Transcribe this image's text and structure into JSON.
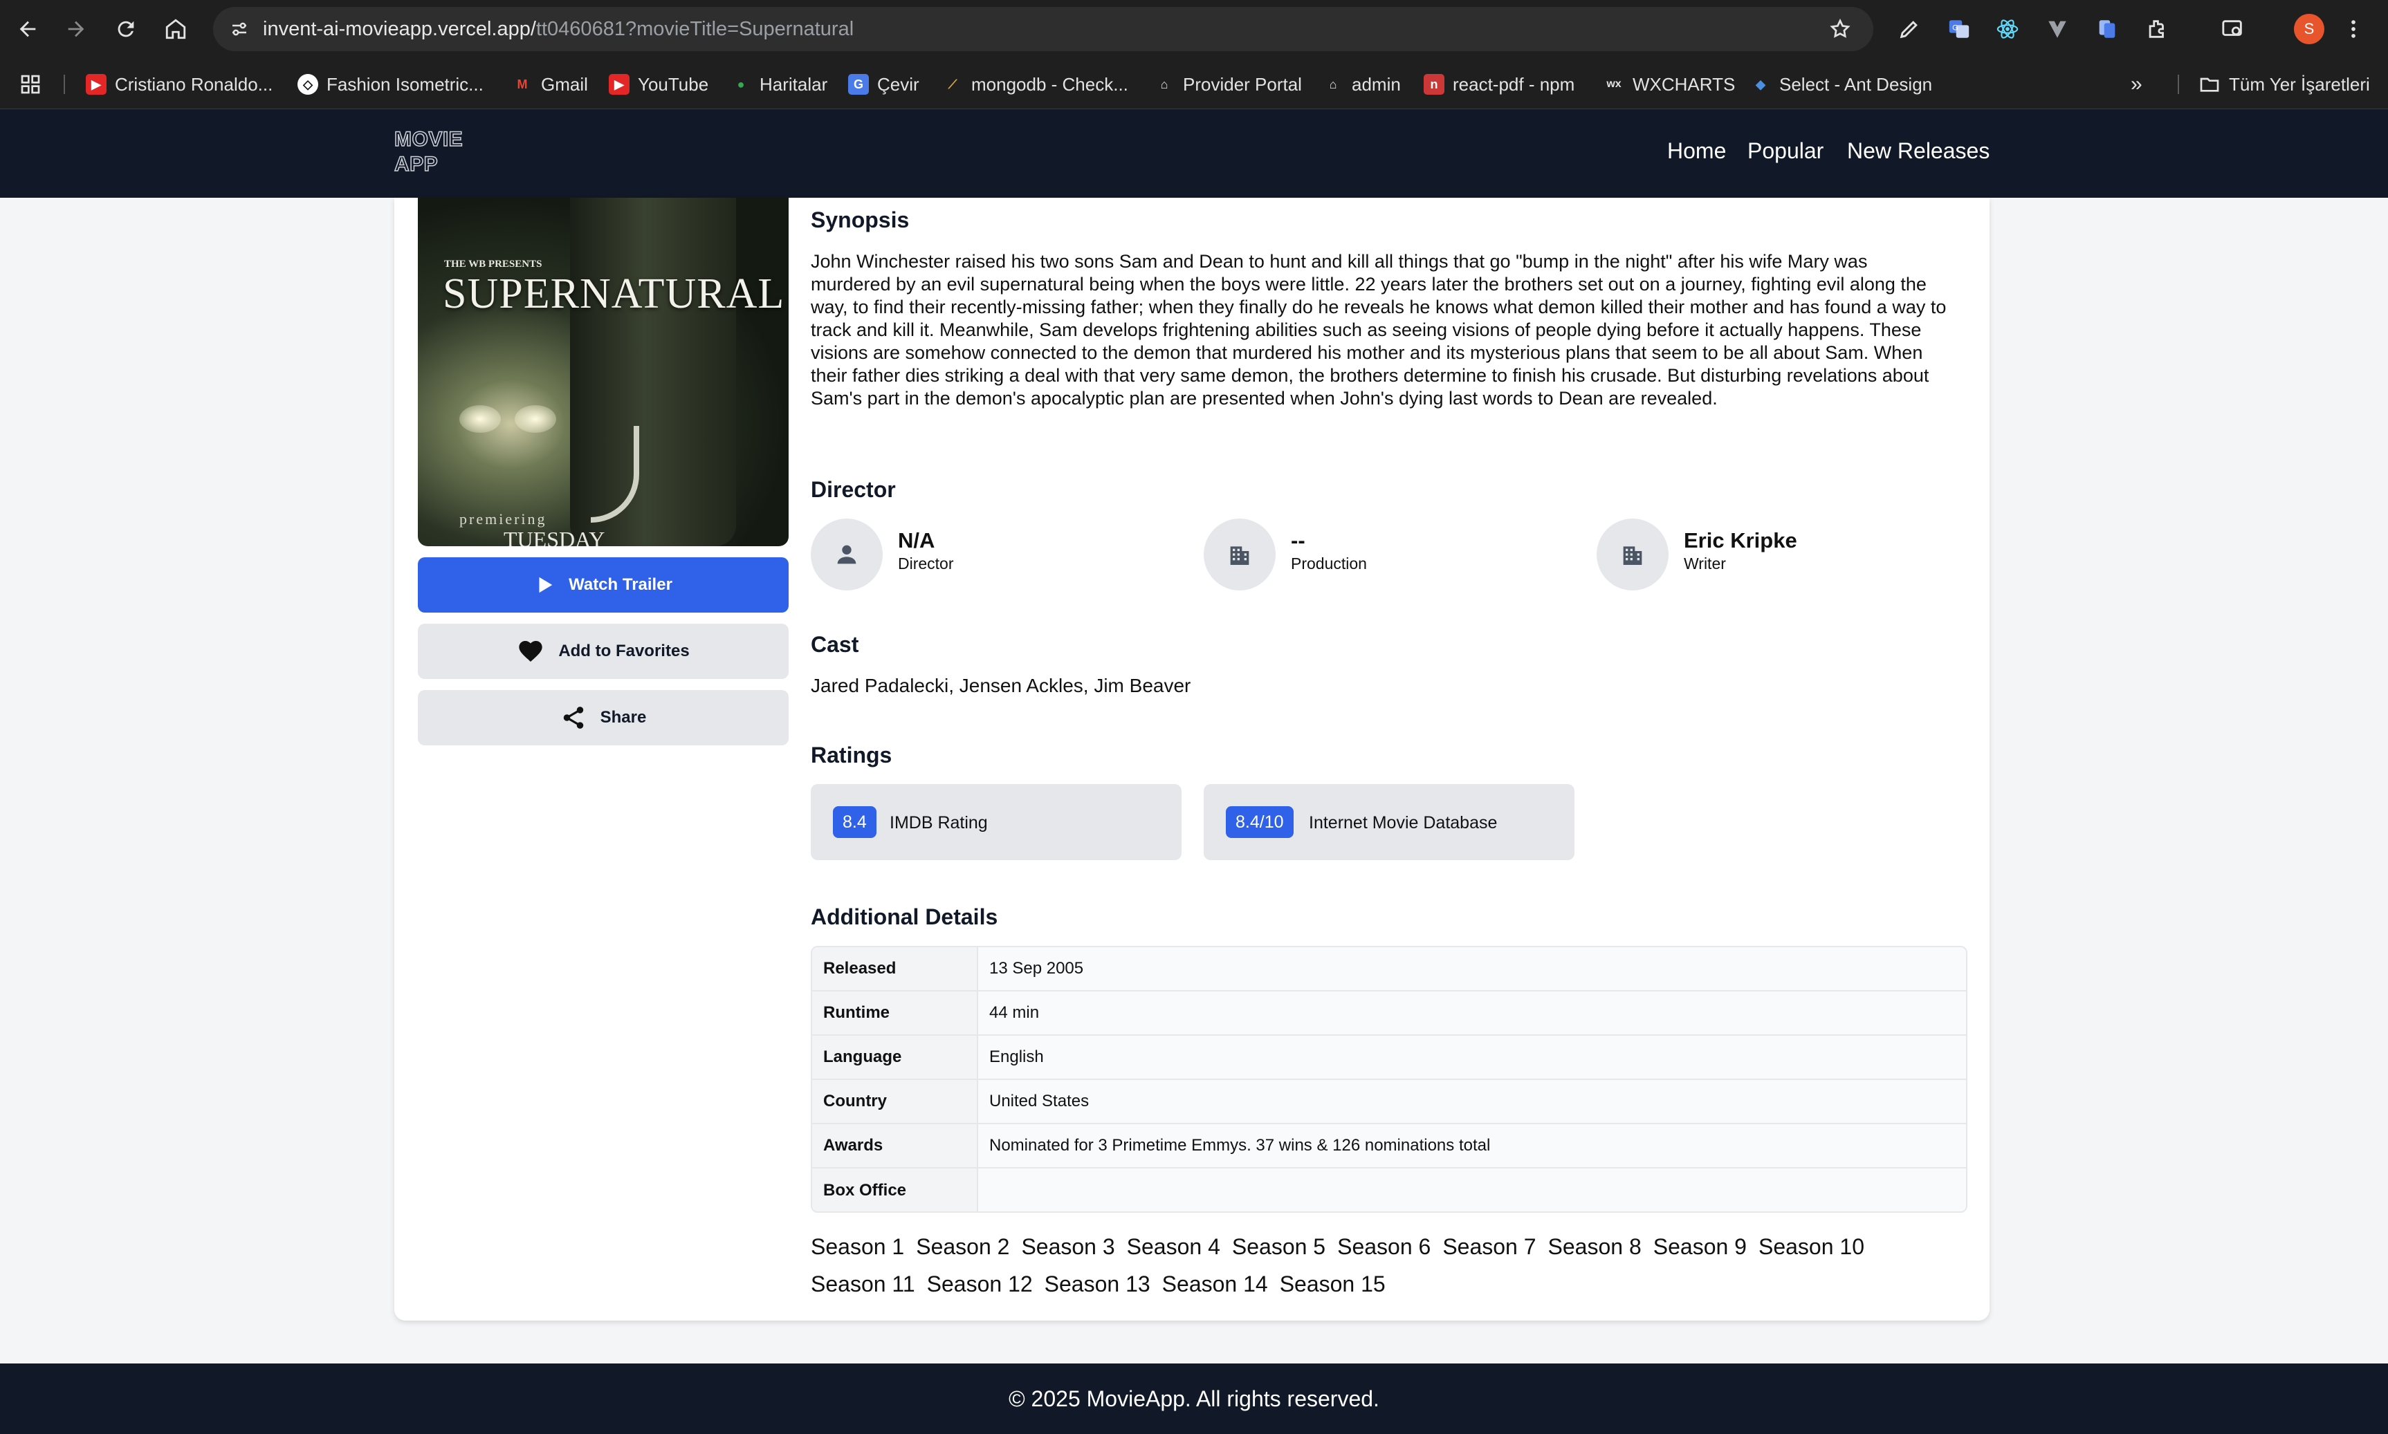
{
  "browser": {
    "url_host": "invent-ai-movieapp.vercel.app/",
    "url_path": "tt0460681?movieTitle=Supernatural",
    "profile_initial": "S",
    "bookmarks": [
      {
        "label": "Cristiano Ronaldo...",
        "icon": "youtube-icon"
      },
      {
        "label": "Fashion Isometric...",
        "icon": "codepen-icon"
      },
      {
        "label": "Gmail",
        "icon": "gmail-icon"
      },
      {
        "label": "YouTube",
        "icon": "youtube-icon"
      },
      {
        "label": "Haritalar",
        "icon": "maps-pin-icon"
      },
      {
        "label": "Çevir",
        "icon": "translate-icon"
      },
      {
        "label": "mongodb - Check...",
        "icon": "mongodb-icon"
      },
      {
        "label": "Provider Portal",
        "icon": "home-icon"
      },
      {
        "label": "admin",
        "icon": "home-icon"
      },
      {
        "label": "react-pdf - npm",
        "icon": "npm-icon"
      },
      {
        "label": "WXCHARTS",
        "icon": "wx-icon"
      },
      {
        "label": "Select - Ant Design",
        "icon": "ant-design-icon"
      }
    ],
    "all_bookmarks_label": "Tüm Yer İşaretleri"
  },
  "app": {
    "logo_line1": "MOVIE",
    "logo_line2": "APP",
    "nav": [
      "Home",
      "Popular",
      "New Releases"
    ]
  },
  "poster": {
    "presents": "THE WB PRESENTS",
    "title": "SUPERNATURAL",
    "premiering": "premiering",
    "day": "TUESDAY"
  },
  "actions": {
    "watch_trailer": "Watch Trailer",
    "add_favorites": "Add to Favorites",
    "share": "Share"
  },
  "synopsis": {
    "heading": "Synopsis",
    "text": "John Winchester raised his two sons Sam and Dean to hunt and kill all things that go \"bump in the night\" after his wife Mary was murdered by an evil supernatural being when the boys were little. 22 years later the brothers set out on a journey, fighting evil along the way, to find their recently-missing father; when they finally do he reveals he knows what demon killed their mother and has found a way to track and kill it. Meanwhile, Sam develops frightening abilities such as seeing visions of people dying before it actually happens. These visions are somehow connected to the demon that murdered his mother and its mysterious plans that seem to be all about Sam. When their father dies striking a deal with that very same demon, the brothers determine to finish his crusade. But disturbing revelations about Sam's part in the demon's apocalyptic plan are presented when John's dying last words to Dean are revealed."
  },
  "crew": {
    "heading": "Director",
    "items": [
      {
        "name": "N/A",
        "role": "Director",
        "icon": "person-icon"
      },
      {
        "name": "--",
        "role": "Production",
        "icon": "building-icon"
      },
      {
        "name": "Eric Kripke",
        "role": "Writer",
        "icon": "building-icon"
      }
    ]
  },
  "cast": {
    "heading": "Cast",
    "text": "Jared Padalecki, Jensen Ackles, Jim Beaver"
  },
  "ratings": {
    "heading": "Ratings",
    "items": [
      {
        "value": "8.4",
        "label": "IMDB Rating"
      },
      {
        "value": "8.4/10",
        "label": "Internet Movie Database"
      }
    ]
  },
  "details": {
    "heading": "Additional Details",
    "rows": [
      {
        "key": "Released",
        "value": "13 Sep 2005"
      },
      {
        "key": "Runtime",
        "value": "44 min"
      },
      {
        "key": "Language",
        "value": "English"
      },
      {
        "key": "Country",
        "value": "United States"
      },
      {
        "key": "Awards",
        "value": "Nominated for 3 Primetime Emmys. 37 wins & 126 nominations total"
      },
      {
        "key": "Box Office",
        "value": ""
      }
    ]
  },
  "seasons": [
    "Season 1",
    "Season 2",
    "Season 3",
    "Season 4",
    "Season 5",
    "Season 6",
    "Season 7",
    "Season 8",
    "Season 9",
    "Season 10",
    "Season 11",
    "Season 12",
    "Season 13",
    "Season 14",
    "Season 15"
  ],
  "footer": {
    "text": "© 2025 MovieApp. All rights reserved."
  },
  "colors": {
    "header_bg": "#111827",
    "primary": "#2f62e8",
    "chrome_bg": "#1f1f1f"
  }
}
